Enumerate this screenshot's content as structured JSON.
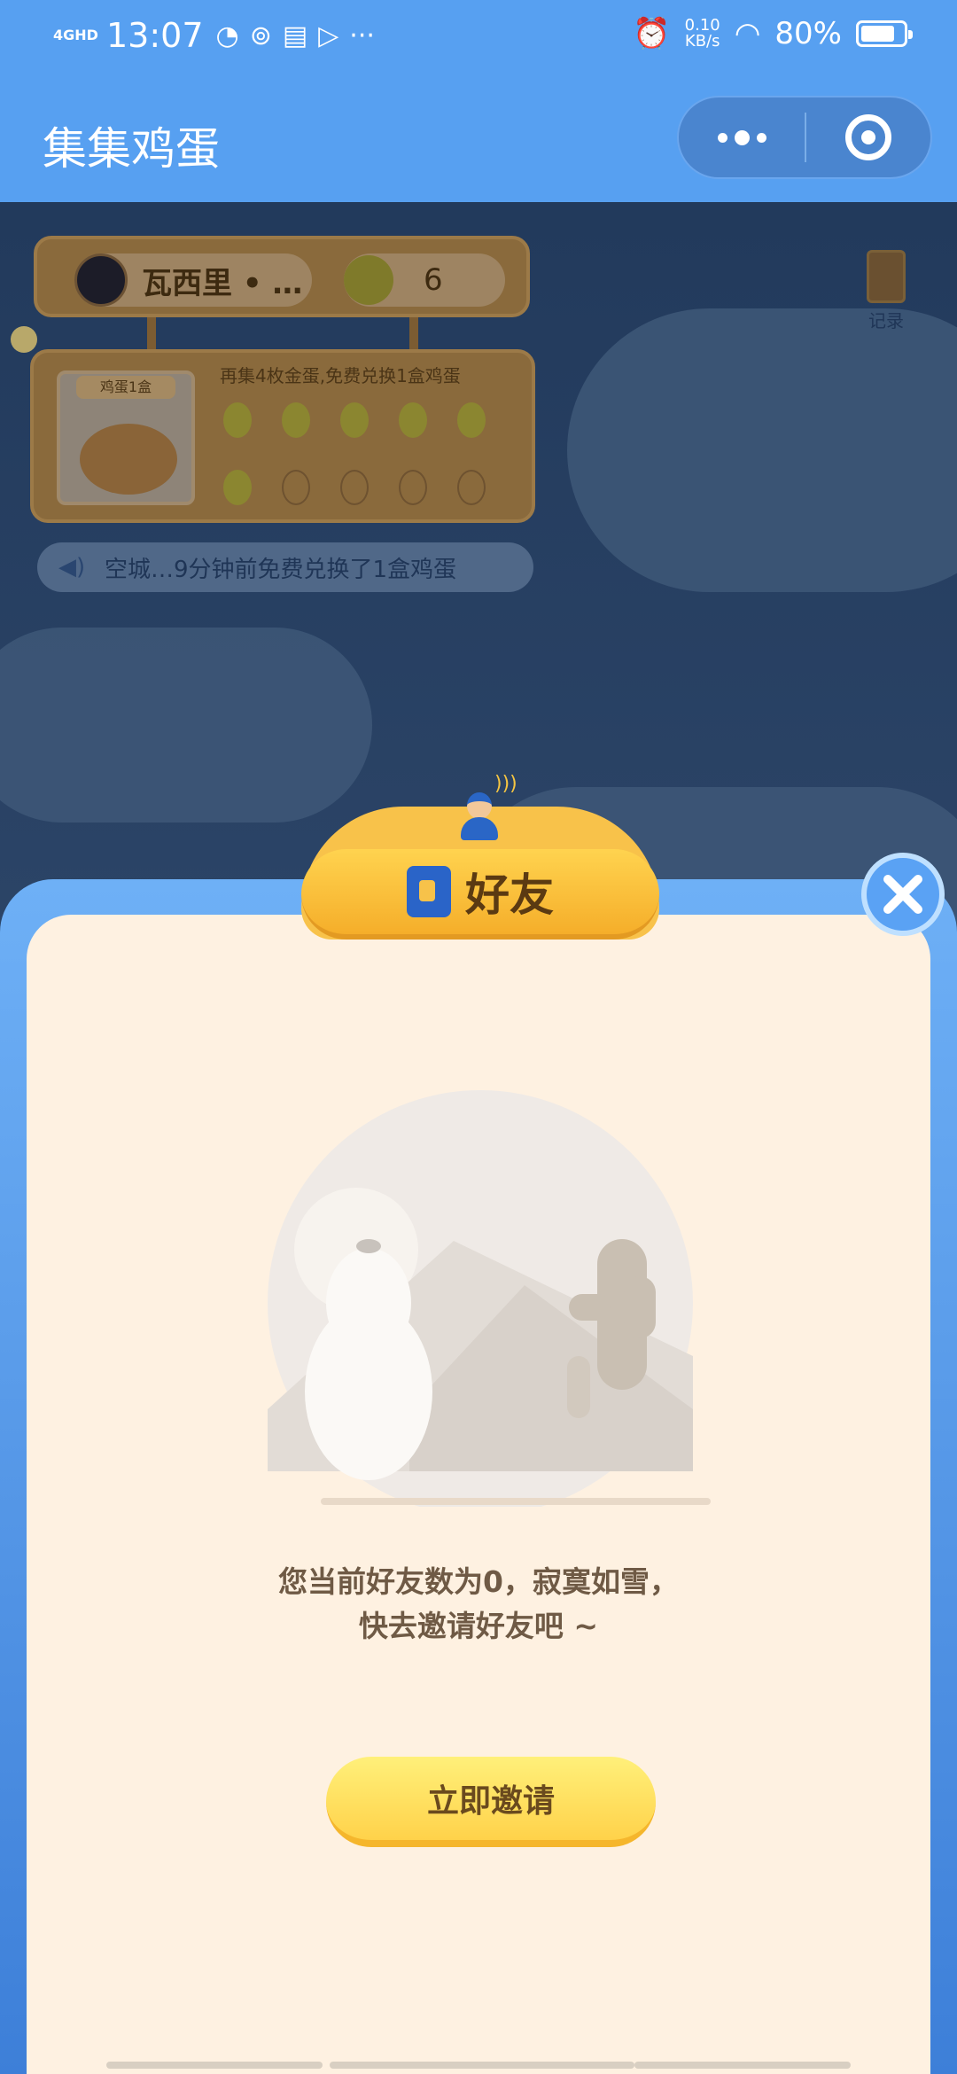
{
  "status_bar": {
    "network": "4GHD",
    "time": "13:07",
    "net_speed_value": "0.10",
    "net_speed_unit": "KB/s",
    "battery": "80%",
    "battery_level": 0.8
  },
  "title_bar": {
    "title": "集集鸡蛋"
  },
  "scene": {
    "username": "瓦西里 • …",
    "coin_count": "6",
    "egg_card_label": "鸡蛋1盒",
    "egg_tip": "再集4枚金蛋,免费兑换1盒鸡蛋",
    "eggs_collected": 6,
    "eggs_total": 10,
    "ticker": "空城…9分钟前免费兑换了1盒鸡蛋",
    "record_label": "记录"
  },
  "modal": {
    "title": "好友",
    "empty_line1": "您当前好友数为0，寂寞如雪，",
    "empty_line2": "快去邀请好友吧 ~",
    "invite_button": "立即邀请"
  }
}
